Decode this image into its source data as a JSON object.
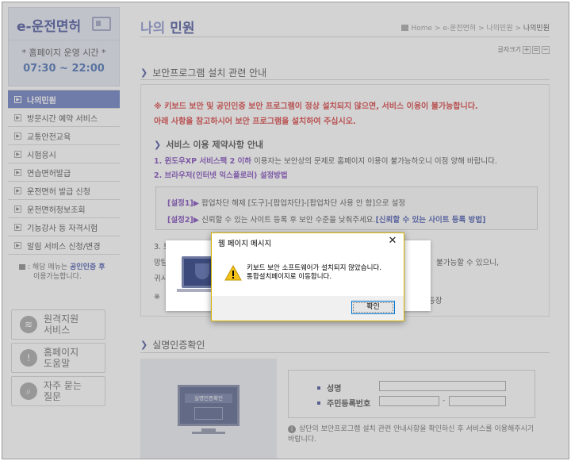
{
  "sidebar": {
    "logo": "e-운전면허",
    "hours_title": "* 홈페이지 운영 시간 *",
    "hours_time": "07:30 ~ 22:00",
    "menu": [
      {
        "label": "나의민원",
        "active": true
      },
      {
        "label": "방문시간 예약 서비스"
      },
      {
        "label": "교통안전교육"
      },
      {
        "label": "시험응시"
      },
      {
        "label": "연습면허발급"
      },
      {
        "label": "운전면허 발급 신청"
      },
      {
        "label": "운전면허정보조회"
      },
      {
        "label": "기능강사 등 자격시험"
      },
      {
        "label": "알림 서비스 신청/변경"
      }
    ],
    "note_prefix": ": 해당 메뉴는 ",
    "note_link": "공인인증 후",
    "note_suffix": "이용가능합니다.",
    "quick": [
      {
        "line1": "원격지원",
        "line2": "서비스",
        "icon": "wifi-icon"
      },
      {
        "line1": "홈페이지",
        "line2": "도움말",
        "icon": "help-icon"
      },
      {
        "line1": "자주 묻는",
        "line2": "질문",
        "icon": "search-icon"
      }
    ]
  },
  "main": {
    "title_light": "나의",
    "title_bold": " 민원",
    "breadcrumb": [
      "Home",
      "e-운전면허",
      "나의민원"
    ],
    "breadcrumb_current": "나의민원",
    "font_size_label": "글자크기",
    "font_buttons": [
      "+",
      "=",
      "−"
    ],
    "section1_title": "보안프로그램 설치 관련 안내",
    "warn1": "※ 키보드 보안 및 공인인증 보안 프로그램이 정상 설치되지 않으면, 서비스 이용이 불가능합니다.",
    "warn2": "아래 사항을 참고하시어 보안 프로그램을 설치하여 주십시오.",
    "restrict_title": "서비스 이용 제약사항 안내",
    "r1_hl": "1. 윈도우XP 서비스팩 2 이하",
    "r1_rest": " 이용자는 보안상의 문제로 홈페이지 이용이 불가능하오니 이점 양해 바랍니다.",
    "r2_hl": "2. 브라우저(인터넷 익스플로러) 설정방법",
    "set1_label": "[설정1]▶",
    "set1_text": " 팝업차단 해제 [도구]-[팝업차단]-[팝업차단 사용 안 함]으로 설정",
    "set2_label": "[설정2]▶",
    "set2_text": " 신뢰할 수 있는 사이트 등록 후 보안 수준을 낮춰주세요.",
    "set2_link": "[신뢰할 수 있는 사이트 등록 방법]",
    "r3a": "3. 보",
    "r3b": "망탐",
    "r3c": "귀시",
    "r3d": "※",
    "side1": "불가능할 수 있으니,",
    "side2": ".",
    "side3": "등장",
    "section2_title": "실명인증확인",
    "monitor_label": "실명인증확인",
    "form_name": "성명",
    "form_rrn": "주민등록번호",
    "form_dash": "-",
    "info_text": "상단의 보안프로그램 설치 관련 안내사항을 확인하신 후 서비스를 이용해주시기 바랍니다."
  },
  "dialog": {
    "title": "웹 페이지 메시지",
    "close": "✕",
    "message_line1": "키보드 보안 소프트웨어가 설치되지 않았습니다.",
    "message_line2": "통합설치페이지로 이동합니다.",
    "ok_label": "확인",
    "icon": "warning-icon"
  }
}
